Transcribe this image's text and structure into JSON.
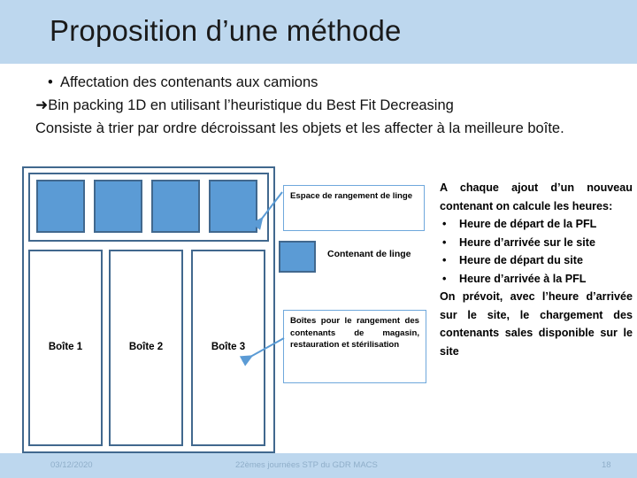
{
  "slide": {
    "title": "Proposition d’une méthode",
    "banner_color": "#BDD7EE",
    "accent_blue": "#5B9BD5",
    "outline_blue": "#41688E"
  },
  "body": {
    "bullet_marker": "•",
    "line1": "Affectation des contenants aux camions",
    "arrow_marker": "➜",
    "line2": "Bin packing 1D en utilisant l’heuristique du Best Fit Decreasing",
    "line3": "Consiste à trier par ordre décroissant les objets et les affecter à la meilleure boîte."
  },
  "diagram": {
    "shelf_items": [
      "container-1",
      "container-2",
      "container-3",
      "container-4"
    ],
    "boxes": [
      {
        "label": "Boîte 1"
      },
      {
        "label": "Boîte 2"
      },
      {
        "label": "Boîte 3"
      }
    ]
  },
  "callouts": {
    "espace": "Espace de rangement de linge",
    "boites": "Boîtes pour le rangement des contenants de magasin, restauration et stérilisation"
  },
  "legend": {
    "swatch_color": "#5B9BD5",
    "label": "Contenant de linge"
  },
  "right_text": {
    "intro": "A chaque ajout d’un nouveau contenant on calcule les heures:",
    "bullet_marker": "•",
    "bullets": [
      "Heure de départ de la PFL",
      "Heure d’arrivée sur le site",
      "Heure de départ du site",
      "Heure d’arrivée à la PFL"
    ],
    "outro": "On prévoit, avec l’heure d’arrivée sur le site, le chargement des contenants sales disponible sur le site"
  },
  "footer": {
    "date": "03/12/2020",
    "center": "22èmes journées STP du GDR MACS",
    "page": "18"
  }
}
